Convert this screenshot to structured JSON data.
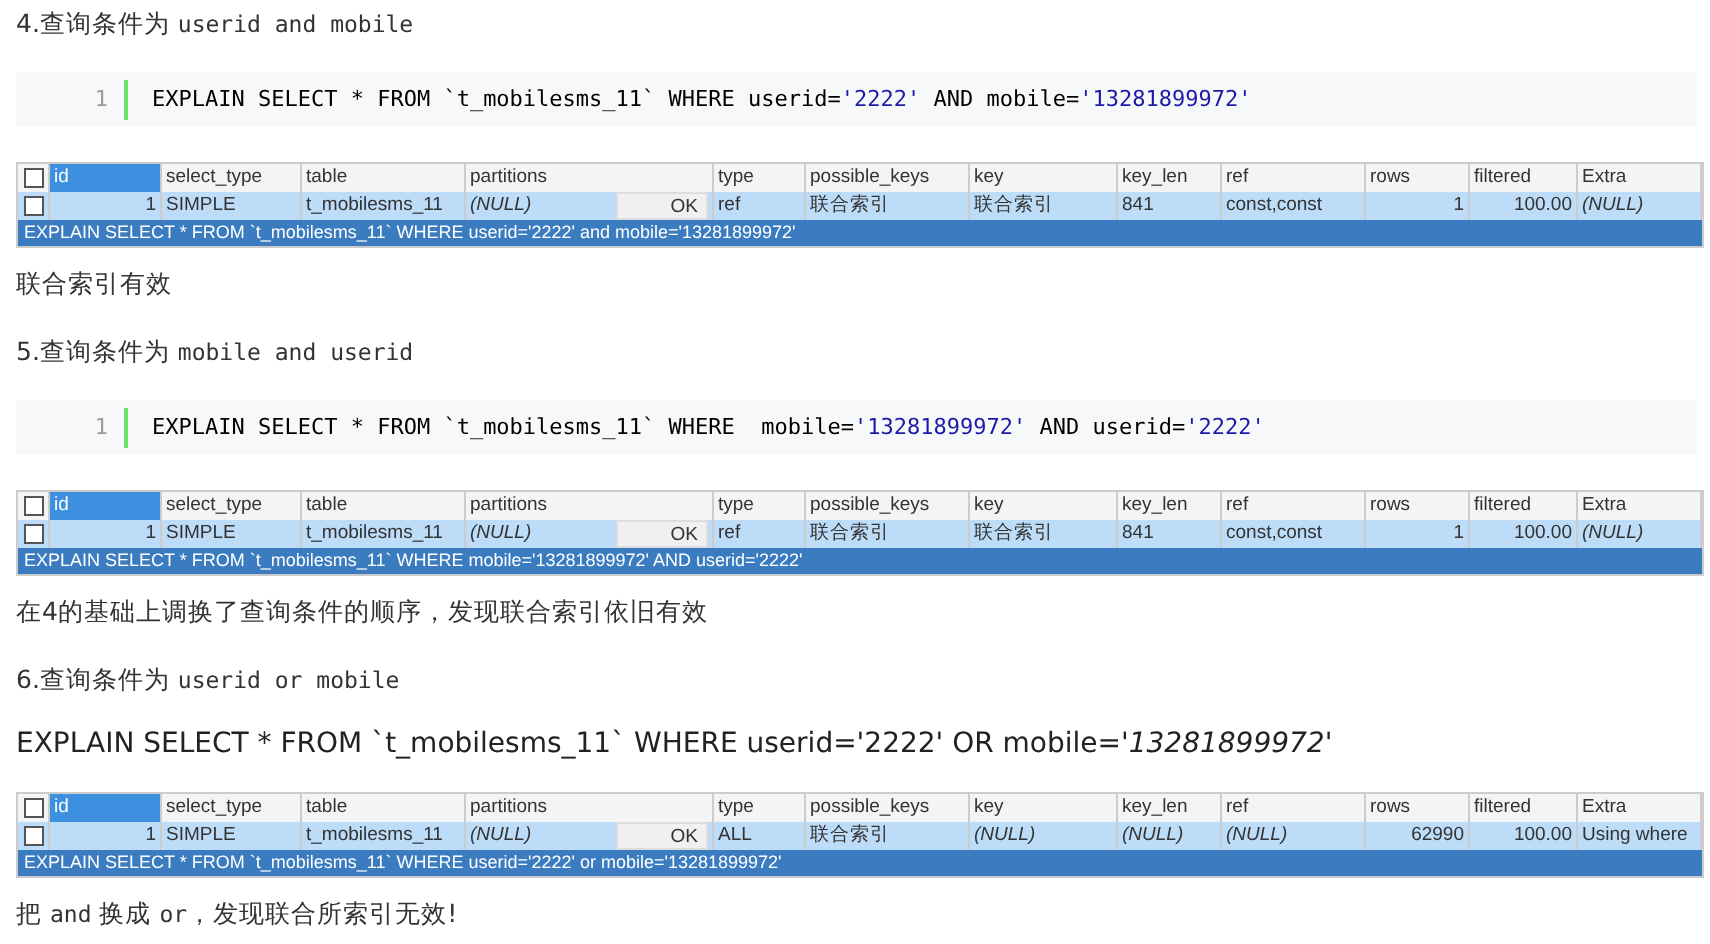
{
  "sections": [
    {
      "heading": [
        {
          "kind": "text",
          "text": "4.查询条件为 "
        },
        {
          "kind": "code",
          "text": "userid and mobile"
        }
      ],
      "query": {
        "kind": "code",
        "line": "1",
        "parts": [
          {
            "kind": "plain",
            "text": "EXPLAIN SELECT * FROM `t_mobilesms_11` WHERE userid="
          },
          {
            "kind": "string",
            "text": "'2222'"
          },
          {
            "kind": "plain",
            "text": " AND mobile="
          },
          {
            "kind": "string",
            "text": "'13281899972'"
          }
        ]
      },
      "grid": {
        "header_checkbox": {
          "checked": false
        },
        "columns": [
          {
            "label": "id",
            "selected": true
          },
          {
            "label": "select_type",
            "selected": false
          },
          {
            "label": "table",
            "selected": false
          },
          {
            "label": "partitions",
            "selected": false
          },
          {
            "label": "type",
            "selected": false
          },
          {
            "label": "possible_keys",
            "selected": false
          },
          {
            "label": "key",
            "selected": false
          },
          {
            "label": "key_len",
            "selected": false
          },
          {
            "label": "ref",
            "selected": false
          },
          {
            "label": "rows",
            "selected": false
          },
          {
            "label": "filtered",
            "selected": false
          },
          {
            "label": "Extra",
            "selected": false
          }
        ],
        "rows": [
          {
            "checked": false,
            "selected": true,
            "cells": [
              {
                "text": "1",
                "italic": false
              },
              {
                "text": "SIMPLE",
                "italic": false
              },
              {
                "text": "t_mobilesms_11",
                "italic": false
              },
              {
                "text": "(NULL)",
                "italic": true,
                "button": "OK"
              },
              {
                "text": "ref",
                "italic": false
              },
              {
                "text": "联合索引",
                "italic": false
              },
              {
                "text": "联合索引",
                "italic": false
              },
              {
                "text": "841",
                "italic": false
              },
              {
                "text": "const,const",
                "italic": false
              },
              {
                "text": "1",
                "italic": false
              },
              {
                "text": "100.00",
                "italic": false
              },
              {
                "text": "(NULL)",
                "italic": true
              }
            ]
          }
        ],
        "status": "EXPLAIN SELECT * FROM `t_mobilesms_11` WHERE userid='2222' and mobile='13281899972'"
      },
      "note": [
        {
          "kind": "text",
          "text": "联合索引有效"
        }
      ]
    },
    {
      "heading": [
        {
          "kind": "text",
          "text": "5.查询条件为 "
        },
        {
          "kind": "code",
          "text": "mobile and userid"
        }
      ],
      "query": {
        "kind": "code",
        "line": "1",
        "parts": [
          {
            "kind": "plain",
            "text": "EXPLAIN SELECT * FROM `t_mobilesms_11` WHERE  mobile="
          },
          {
            "kind": "string",
            "text": "'13281899972'"
          },
          {
            "kind": "plain",
            "text": " AND userid="
          },
          {
            "kind": "string",
            "text": "'2222'"
          }
        ]
      },
      "grid": {
        "header_checkbox": {
          "checked": false
        },
        "columns": [
          {
            "label": "id",
            "selected": true
          },
          {
            "label": "select_type",
            "selected": false
          },
          {
            "label": "table",
            "selected": false
          },
          {
            "label": "partitions",
            "selected": false
          },
          {
            "label": "type",
            "selected": false
          },
          {
            "label": "possible_keys",
            "selected": false
          },
          {
            "label": "key",
            "selected": false
          },
          {
            "label": "key_len",
            "selected": false
          },
          {
            "label": "ref",
            "selected": false
          },
          {
            "label": "rows",
            "selected": false
          },
          {
            "label": "filtered",
            "selected": false
          },
          {
            "label": "Extra",
            "selected": false
          }
        ],
        "rows": [
          {
            "checked": false,
            "selected": true,
            "cells": [
              {
                "text": "1",
                "italic": false
              },
              {
                "text": "SIMPLE",
                "italic": false
              },
              {
                "text": "t_mobilesms_11",
                "italic": false
              },
              {
                "text": "(NULL)",
                "italic": true,
                "button": "OK"
              },
              {
                "text": "ref",
                "italic": false
              },
              {
                "text": "联合索引",
                "italic": false
              },
              {
                "text": "联合索引",
                "italic": false
              },
              {
                "text": "841",
                "italic": false
              },
              {
                "text": "const,const",
                "italic": false
              },
              {
                "text": "1",
                "italic": false
              },
              {
                "text": "100.00",
                "italic": false
              },
              {
                "text": "(NULL)",
                "italic": true
              }
            ]
          }
        ],
        "status": "EXPLAIN SELECT * FROM `t_mobilesms_11` WHERE mobile='13281899972' AND userid='2222'"
      },
      "note": [
        {
          "kind": "text",
          "text": "在4的基础上调换了查询条件的顺序，发现联合索引依旧有效"
        }
      ]
    },
    {
      "heading": [
        {
          "kind": "text",
          "text": "6.查询条件为 "
        },
        {
          "kind": "code",
          "text": "userid or mobile"
        }
      ],
      "query": {
        "kind": "plain",
        "parts": [
          {
            "kind": "plain",
            "text": "EXPLAIN SELECT * FROM `t_mobilesms_11` WHERE userid='2222' OR mobile="
          },
          {
            "kind": "italic",
            "text": "'13281899972'"
          }
        ]
      },
      "grid": {
        "header_checkbox": {
          "checked": false
        },
        "columns": [
          {
            "label": "id",
            "selected": true
          },
          {
            "label": "select_type",
            "selected": false
          },
          {
            "label": "table",
            "selected": false
          },
          {
            "label": "partitions",
            "selected": false
          },
          {
            "label": "type",
            "selected": false
          },
          {
            "label": "possible_keys",
            "selected": false
          },
          {
            "label": "key",
            "selected": false
          },
          {
            "label": "key_len",
            "selected": false
          },
          {
            "label": "ref",
            "selected": false
          },
          {
            "label": "rows",
            "selected": false
          },
          {
            "label": "filtered",
            "selected": false
          },
          {
            "label": "Extra",
            "selected": false
          }
        ],
        "rows": [
          {
            "checked": false,
            "selected": true,
            "cells": [
              {
                "text": "1",
                "italic": false
              },
              {
                "text": "SIMPLE",
                "italic": false
              },
              {
                "text": "t_mobilesms_11",
                "italic": false
              },
              {
                "text": "(NULL)",
                "italic": true,
                "button": "OK"
              },
              {
                "text": "ALL",
                "italic": false
              },
              {
                "text": "联合索引",
                "italic": false
              },
              {
                "text": "(NULL)",
                "italic": true
              },
              {
                "text": "(NULL)",
                "italic": true
              },
              {
                "text": "(NULL)",
                "italic": true
              },
              {
                "text": "62990",
                "italic": false
              },
              {
                "text": "100.00",
                "italic": false
              },
              {
                "text": "Using where",
                "italic": false
              }
            ]
          }
        ],
        "status": "EXPLAIN SELECT * FROM `t_mobilesms_11` WHERE userid='2222' or mobile='13281899972'"
      },
      "note": [
        {
          "kind": "text",
          "text": "把 "
        },
        {
          "kind": "code",
          "text": "and"
        },
        {
          "kind": "text",
          "text": " 换成 "
        },
        {
          "kind": "code",
          "text": "or"
        },
        {
          "kind": "text",
          "text": "，发现联合所索引无效!"
        }
      ]
    }
  ]
}
